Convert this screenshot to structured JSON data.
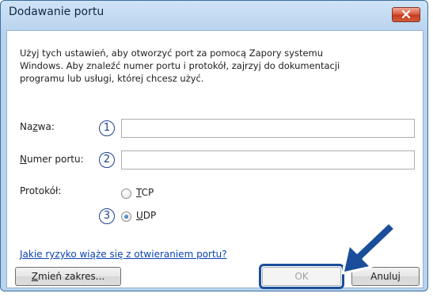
{
  "window": {
    "title": "Dodawanie portu",
    "close_icon": "close-icon"
  },
  "description": {
    "line1": "Użyj tych ustawień, aby otworzyć port za pomocą Zapory systemu",
    "line2": "Windows. Aby znaleźć numer portu i protokół, zajrzyj do dokumentacji",
    "line3": "programu lub usługi, której chcesz użyć."
  },
  "form": {
    "name": {
      "label_prefix": "Na",
      "label_accel": "z",
      "label_suffix": "wa:",
      "value": "",
      "callout": "1"
    },
    "port": {
      "label_accel": "N",
      "label_suffix": "umer portu:",
      "value": "",
      "callout": "2"
    },
    "protocol": {
      "label": "Protokół:",
      "options": [
        {
          "accel": "T",
          "rest": "CP",
          "selected": false
        },
        {
          "accel": "U",
          "rest": "DP",
          "selected": true
        }
      ],
      "callout": "3"
    }
  },
  "risk_link": "Jakie ryzyko wiąże się z otwieraniem portu?",
  "buttons": {
    "change_scope": {
      "accel": "Z",
      "rest": "mień zakres..."
    },
    "ok": "OK",
    "cancel": "Anuluj"
  },
  "colors": {
    "callout": "#1f3f8f",
    "arrow": "#1a4e9a",
    "link": "#0b43b5"
  }
}
